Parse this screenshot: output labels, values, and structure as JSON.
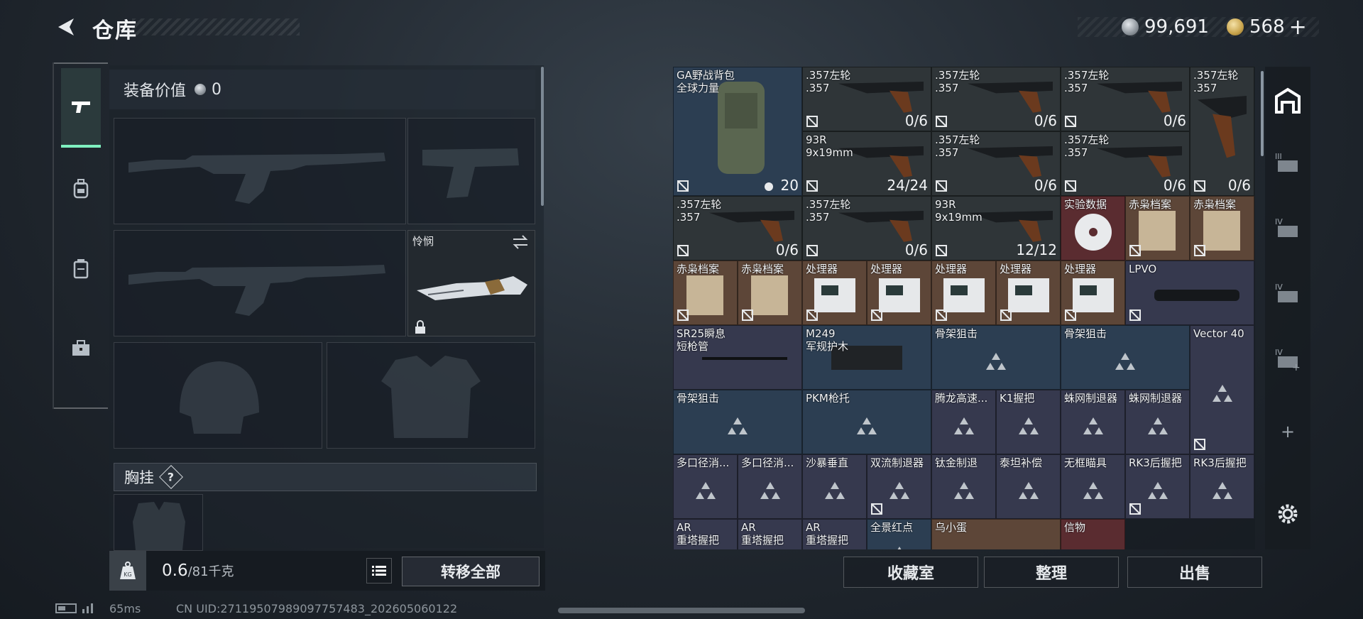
{
  "header": {
    "title": "仓库",
    "currency_silver": "99,691",
    "currency_gold": "568",
    "plus_label": "+"
  },
  "left_rail": {
    "tabs": [
      "pistol-icon",
      "backpack-icon",
      "rig-icon",
      "toolbox-icon"
    ]
  },
  "loadout": {
    "equip_value_label": "装备价值",
    "equip_value": "0",
    "knife_slot_name": "怜悯",
    "chest_rig_label": "胸挂",
    "chest_rig_help": "?",
    "weight_value": "0.6",
    "weight_capacity": "/81千克",
    "weight_icon_label": "KG",
    "transfer_all": "转移全部"
  },
  "inventory": {
    "items": [
      {
        "name": "GA野战背包\n全球力量",
        "count": "20",
        "rarity": "blue"
      },
      {
        "name": ".357左轮\n.357",
        "count": "0/6",
        "rarity": "gray"
      },
      {
        "name": ".357左轮\n.357",
        "count": "0/6",
        "rarity": "gray"
      },
      {
        "name": ".357左轮\n.357",
        "count": "0/6",
        "rarity": "gray"
      },
      {
        "name": ".357左轮\n.357",
        "count": "0/6",
        "rarity": "gray"
      },
      {
        "name": "93R\n9x19mm",
        "count": "24/24",
        "rarity": "gray"
      },
      {
        "name": ".357左轮\n.357",
        "count": "0/6",
        "rarity": "gray"
      },
      {
        "name": ".357左轮\n.357",
        "count": "0/6",
        "rarity": "gray"
      },
      {
        "name": ".357左轮\n.357",
        "count": "0/6",
        "rarity": "gray"
      },
      {
        "name": ".357左轮\n.357",
        "count": "0/6",
        "rarity": "gray"
      },
      {
        "name": "93R\n9x19mm",
        "count": "12/12",
        "rarity": "gray"
      },
      {
        "name": "实验数据",
        "count": "",
        "rarity": "red"
      },
      {
        "name": "赤枭档案",
        "count": "",
        "rarity": "orange"
      },
      {
        "name": "赤枭档案",
        "count": "",
        "rarity": "orange"
      },
      {
        "name": "赤枭档案",
        "count": "",
        "rarity": "orange"
      },
      {
        "name": "赤枭档案",
        "count": "",
        "rarity": "orange"
      },
      {
        "name": "处理器",
        "count": "",
        "rarity": "orange"
      },
      {
        "name": "处理器",
        "count": "",
        "rarity": "orange"
      },
      {
        "name": "处理器",
        "count": "",
        "rarity": "orange"
      },
      {
        "name": "处理器",
        "count": "",
        "rarity": "orange"
      },
      {
        "name": "处理器",
        "count": "",
        "rarity": "orange"
      },
      {
        "name": "LPVO",
        "count": "",
        "rarity": "purple"
      },
      {
        "name": "SR25瞬息\n短枪管",
        "count": "",
        "rarity": "purple"
      },
      {
        "name": "M249\n军规护木",
        "count": "",
        "rarity": "blue"
      },
      {
        "name": "骨架狙击",
        "count": "",
        "rarity": "blue"
      },
      {
        "name": "骨架狙击",
        "count": "",
        "rarity": "blue"
      },
      {
        "name": "Vector 40",
        "count": "",
        "rarity": "purple"
      },
      {
        "name": "骨架狙击",
        "count": "",
        "rarity": "blue"
      },
      {
        "name": "PKM枪托",
        "count": "",
        "rarity": "blue"
      },
      {
        "name": "腾龙高速...",
        "count": "",
        "rarity": "purple"
      },
      {
        "name": "K1握把",
        "count": "",
        "rarity": "purple"
      },
      {
        "name": "蛛网制退器",
        "count": "",
        "rarity": "purple"
      },
      {
        "name": "蛛网制退器",
        "count": "",
        "rarity": "purple"
      },
      {
        "name": "多口径消...",
        "count": "",
        "rarity": "purple"
      },
      {
        "name": "多口径消...",
        "count": "",
        "rarity": "purple"
      },
      {
        "name": "沙暴垂直",
        "count": "",
        "rarity": "purple"
      },
      {
        "name": "双流制退器",
        "count": "",
        "rarity": "purple"
      },
      {
        "name": "钛金制退",
        "count": "",
        "rarity": "purple"
      },
      {
        "name": "泰坦补偿",
        "count": "",
        "rarity": "purple"
      },
      {
        "name": "无框瞄具",
        "count": "",
        "rarity": "purple"
      },
      {
        "name": "RK3后握把",
        "count": "",
        "rarity": "purple"
      },
      {
        "name": "RK3后握把",
        "count": "",
        "rarity": "purple"
      },
      {
        "name": "AR\n重塔握把",
        "count": "",
        "rarity": "purple"
      },
      {
        "name": "AR\n重塔握把",
        "count": "",
        "rarity": "purple"
      },
      {
        "name": "AR\n重塔握把",
        "count": "",
        "rarity": "purple"
      },
      {
        "name": "全景红点",
        "count": "",
        "rarity": "blue"
      },
      {
        "name": "乌小蛋",
        "count": "",
        "rarity": "orange"
      },
      {
        "name": "信物",
        "count": "",
        "rarity": "red"
      }
    ]
  },
  "actions": {
    "collection": "收藏室",
    "organize": "整理",
    "sell": "出售"
  },
  "right_rail": {
    "items": [
      "warehouse-icon",
      "storage-3-icon",
      "storage-4a-icon",
      "storage-4b-icon",
      "storage-4c-icon"
    ],
    "add_label": "+"
  },
  "status": {
    "ping": "65ms",
    "uid": "CN UID:27119507989097757483_202605060122"
  },
  "colors": {
    "accent": "#7ff0c0",
    "gray": "#2f3538",
    "blue": "#2c3e52",
    "purple": "#36394e",
    "orange": "#5d4638",
    "red": "#5a2c30"
  }
}
